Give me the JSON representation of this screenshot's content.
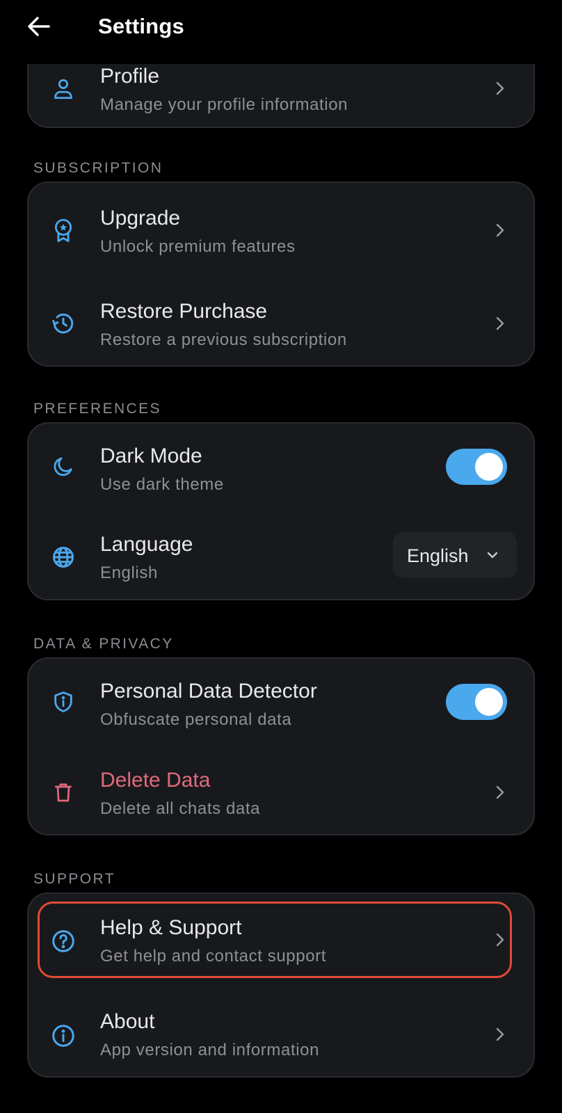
{
  "header": {
    "title": "Settings",
    "back_icon": "arrow-left-icon"
  },
  "colors": {
    "accent": "#4aa8ec",
    "danger": "#e06a7c",
    "highlight": "#e04b34",
    "card_bg": "#18191d",
    "page_bg": "#000000"
  },
  "account": {
    "items": [
      {
        "label": "Profile",
        "sub": "Manage your profile information",
        "icon": "user-icon"
      }
    ]
  },
  "subscription": {
    "heading": "SUBSCRIPTION",
    "items": [
      {
        "label": "Upgrade",
        "sub": "Unlock premium features",
        "icon": "award-badge-icon"
      },
      {
        "label": "Restore Purchase",
        "sub": "Restore a previous subscription",
        "icon": "history-icon"
      }
    ]
  },
  "preferences": {
    "heading": "PREFERENCES",
    "dark_mode": {
      "label": "Dark Mode",
      "sub": "Use dark theme",
      "icon": "moon-icon",
      "enabled": true
    },
    "language": {
      "label": "Language",
      "sub": "English",
      "icon": "globe-icon",
      "selected": "English"
    }
  },
  "privacy": {
    "heading": "DATA & PRIVACY",
    "detector": {
      "label": "Personal Data Detector",
      "sub": "Obfuscate personal data",
      "icon": "shield-info-icon",
      "enabled": true
    },
    "delete": {
      "label": "Delete Data",
      "sub": "Delete all chats data",
      "icon": "trash-icon"
    }
  },
  "support": {
    "heading": "SUPPORT",
    "items": [
      {
        "label": "Help & Support",
        "sub": "Get help and contact support",
        "icon": "help-circle-icon",
        "highlighted": true
      },
      {
        "label": "About",
        "sub": "App version and information",
        "icon": "info-circle-icon"
      }
    ]
  }
}
